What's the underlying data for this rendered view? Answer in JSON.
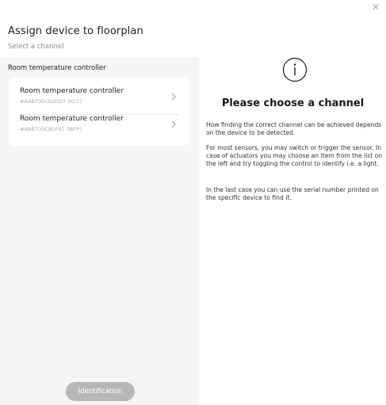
{
  "dialog": {
    "title": "Assign device to floorplan",
    "subtitle": "Select a channel",
    "close_icon": "close-icon"
  },
  "left": {
    "section_label": "Room temperature controller",
    "items": [
      {
        "name": "Room temperature controller",
        "id": "#ABB700C82DD7 (KCC)",
        "icon": "chevron-right-icon"
      },
      {
        "name": "Room temperature controller",
        "id": "#ABB700C8DF67 (WFP)",
        "icon": "chevron-right-icon"
      }
    ],
    "identification_label": "Identification"
  },
  "right": {
    "icon": "info-icon",
    "heading": "Please choose a channel",
    "paragraphs": [
      "How finding the correct channel can be achieved depends on the device to be detected.",
      "For most sensors, you may switch or trigger the sensor. In case of actuators you may choose an item from the list on the left and try toggling the control to identify i.e. a light.",
      "In the last case you can use the serial number printed on the specific device to find it."
    ]
  },
  "colors": {
    "left_panel_bg": "#f5f5f5",
    "button_disabled": "#b7b7b7",
    "muted_text": "#aaaaaa"
  }
}
